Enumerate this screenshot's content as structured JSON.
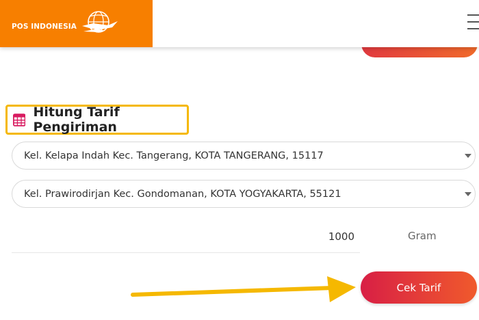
{
  "header": {
    "brand": "POS INDONESIA",
    "brand_color": "#f77f00"
  },
  "section": {
    "title": "Hitung Tarif Pengiriman",
    "icon": "calculator-icon",
    "highlight_color": "#f5b800"
  },
  "form": {
    "origin": "Kel. Kelapa Indah Kec. Tangerang, KOTA TANGERANG, 15117",
    "destination": "Kel. Prawirodirjan Kec. Gondomanan, KOTA YOGYAKARTA, 55121",
    "weight_value": "1000",
    "weight_unit": "Gram"
  },
  "actions": {
    "check_label": "Cek Tarif",
    "button_color": "#e0283f"
  }
}
